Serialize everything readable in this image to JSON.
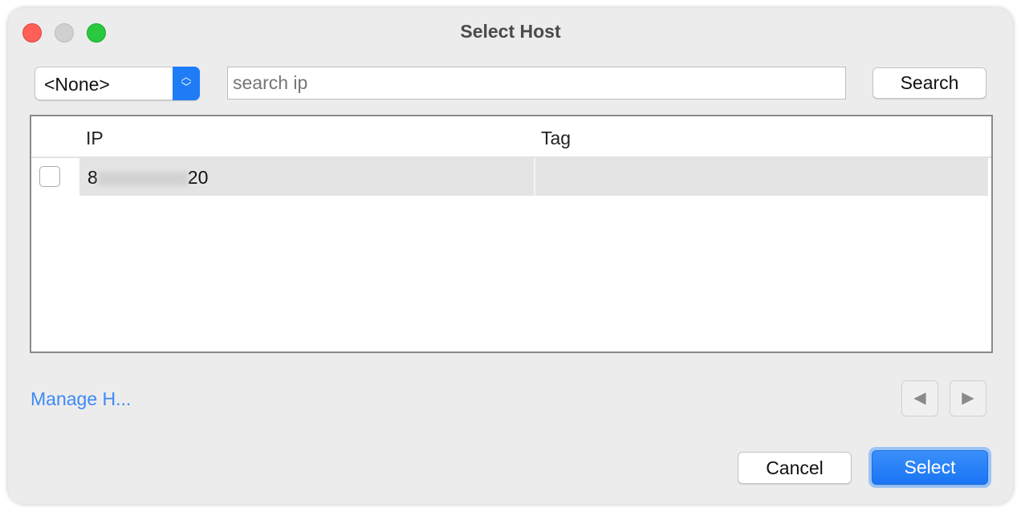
{
  "window": {
    "title": "Select Host"
  },
  "toolbar": {
    "tag_select_value": "<None>",
    "search_placeholder": "search ip",
    "search_value": "",
    "search_label": "Search"
  },
  "table": {
    "columns": [
      "",
      "IP",
      "Tag"
    ],
    "rows": [
      {
        "checked": false,
        "ip_prefix": "8",
        "ip_suffix": "20",
        "tag": ""
      }
    ]
  },
  "footer": {
    "manage_link": "Manage H...",
    "cancel_label": "Cancel",
    "select_label": "Select"
  },
  "colors": {
    "accent": "#1f7cf7",
    "link": "#3d8af7"
  }
}
